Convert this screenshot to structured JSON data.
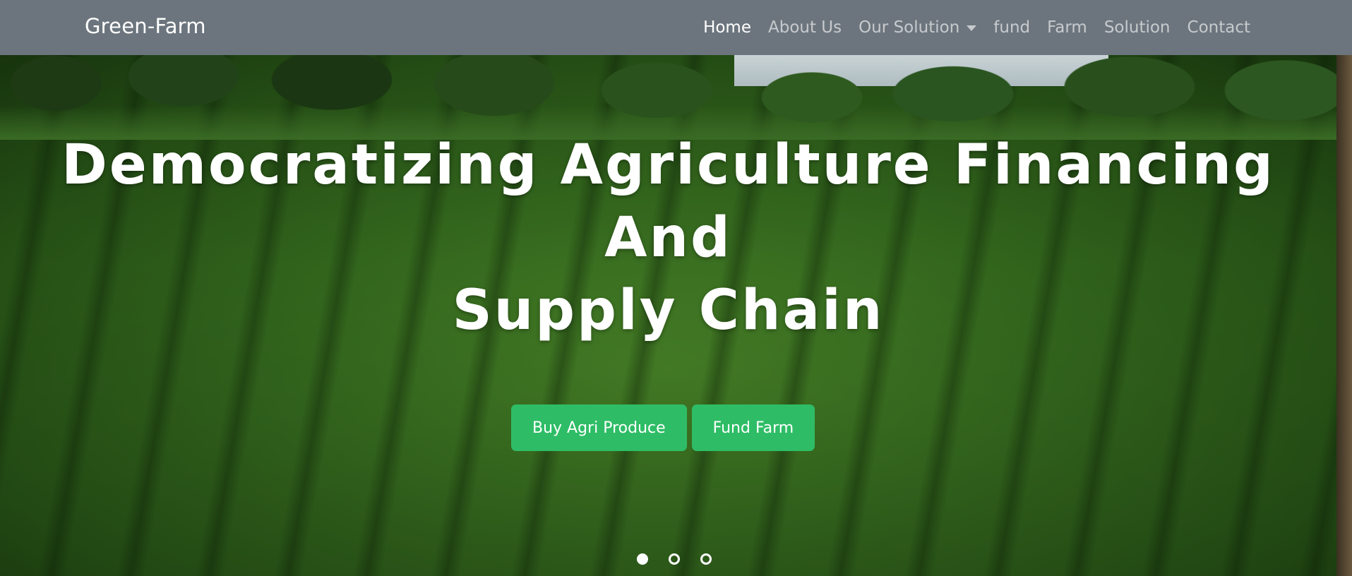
{
  "brand": "Green-Farm",
  "nav": {
    "items": [
      {
        "label": "Home",
        "active": true
      },
      {
        "label": "About Us",
        "active": false
      },
      {
        "label": "Our Solution",
        "active": false,
        "dropdown": true
      },
      {
        "label": "fund",
        "active": false
      },
      {
        "label": "Farm",
        "active": false
      },
      {
        "label": "Solution",
        "active": false
      },
      {
        "label": "Contact",
        "active": false
      }
    ]
  },
  "hero": {
    "headline_line1": "Democratizing Agriculture Financing",
    "headline_line2": "And",
    "headline_line3": "Supply Chain",
    "buttons": {
      "buy": "Buy Agri Produce",
      "fund": "Fund Farm"
    },
    "carousel": {
      "slides": 3,
      "active_index": 0
    }
  },
  "colors": {
    "navbar": "#6c757d",
    "button": "#2ebd66",
    "text": "#ffffff"
  }
}
